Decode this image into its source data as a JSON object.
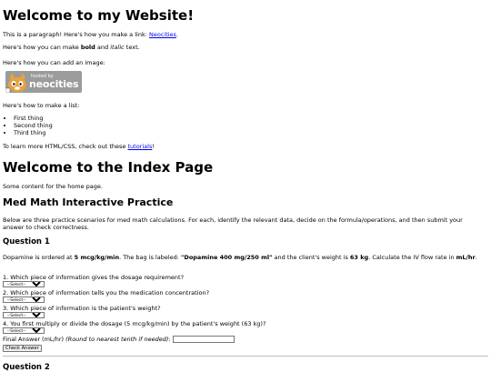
{
  "header": {
    "title": "Welcome to my Website!"
  },
  "intro": {
    "p1_before": "This is a paragraph! Here's how you make a link: ",
    "p1_link": "Neocities",
    "p1_after": ".",
    "p2_before": "Here's how you can make ",
    "p2_bold": "bold",
    "p2_mid": " and ",
    "p2_italic": "italic",
    "p2_after": " text.",
    "p3": "Here's how you can add an image:",
    "badge_small": "hosted by",
    "badge_big": "neocities",
    "p4": "Here's how to make a list:",
    "list": [
      "First thing",
      "Second thing",
      "Third thing"
    ],
    "p5_before": "To learn more HTML/CSS, check out these ",
    "p5_link": "tutorials",
    "p5_after": "!"
  },
  "index": {
    "title": "Welcome to the Index Page",
    "text": "Some content for the home page."
  },
  "practice": {
    "title": "Med Math Interactive Practice",
    "intro": "Below are three practice scenarios for med math calculations. For each, identify the relevant data, decide on the formula/operations, and then submit your answer to check correctness.",
    "q1": {
      "title": "Question 1",
      "t1": "Dopamine is ordered at ",
      "b1": "5 mcg/kg/min",
      "t2": ". The bag is labeled: ",
      "b2": "\"Dopamine 400 mg/250 ml\"",
      "t3": " and the client's weight is ",
      "b3": "63 kg",
      "t4": ". Calculate the IV flow rate in ",
      "b4": "mL/hr",
      "t5": ".",
      "items": [
        "1. Which piece of information gives the dosage requirement?",
        "2. Which piece of information tells you the medication concentration?",
        "3. Which piece of information is the patient's weight?",
        "4. You first multiply or divide the dosage (5 mcg/kg/min) by the patient's weight (63 kg)?"
      ],
      "select_value": "--Select--",
      "final_label": "Final Answer (mL/hr) ",
      "final_hint": "(Round to nearest tenth if needed)",
      "final_colon": ":",
      "final_value": "",
      "check_label": "Check Answer"
    },
    "q2_title": "Question 2"
  }
}
